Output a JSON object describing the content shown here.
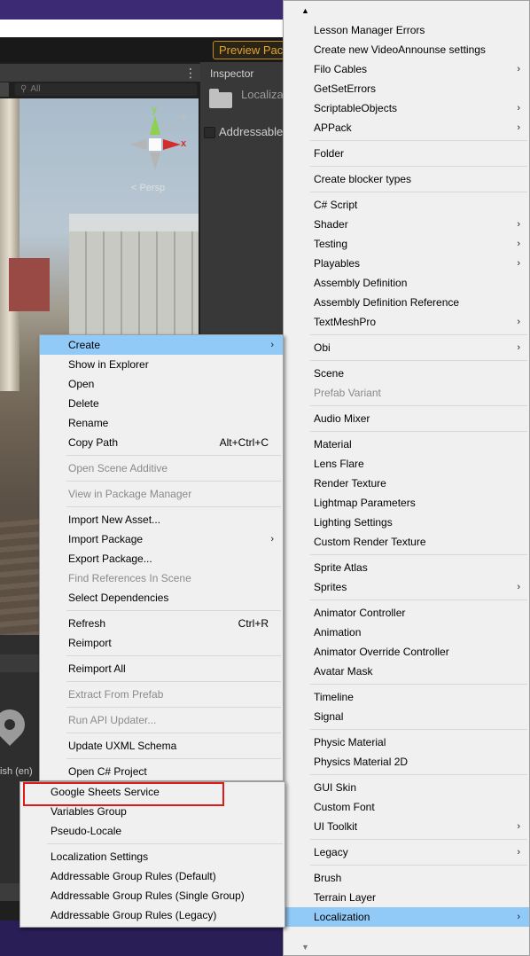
{
  "editor": {
    "preview_button": "Preview Pac",
    "scene_search_placeholder": "All",
    "scene_persp_label": "< Persp",
    "gizmo_y": "y",
    "gizmo_x": "x",
    "inspector_tab": "Inspector",
    "inspector_title": "Localiza",
    "inspector_addressable": "Addressable",
    "locale_label": "ish (en)"
  },
  "context_menu": {
    "items": [
      {
        "label": "Create",
        "arrow": "›"
      },
      {
        "label": "Show in Explorer"
      },
      {
        "label": "Open"
      },
      {
        "label": "Delete"
      },
      {
        "label": "Rename"
      },
      {
        "label": "Copy Path",
        "shortcut": "Alt+Ctrl+C"
      },
      {
        "label": "Open Scene Additive"
      },
      {
        "label": "View in Package Manager"
      },
      {
        "label": "Import New Asset..."
      },
      {
        "label": "Import Package",
        "arrow": "›"
      },
      {
        "label": "Export Package..."
      },
      {
        "label": "Find References In Scene"
      },
      {
        "label": "Select Dependencies"
      },
      {
        "label": "Refresh",
        "shortcut": "Ctrl+R"
      },
      {
        "label": "Reimport"
      },
      {
        "label": "Reimport All"
      },
      {
        "label": "Extract From Prefab"
      },
      {
        "label": "Run API Updater..."
      },
      {
        "label": "Update UXML Schema"
      },
      {
        "label": "Open C# Project"
      }
    ]
  },
  "create_menu": {
    "items": [
      {
        "label": "Lesson Manager Errors"
      },
      {
        "label": "Create new VideoAnnounse settings"
      },
      {
        "label": "Filo Cables",
        "arrow": "›"
      },
      {
        "label": "GetSetErrors"
      },
      {
        "label": "ScriptableObjects",
        "arrow": "›"
      },
      {
        "label": "APPack",
        "arrow": "›"
      },
      {
        "label": "Folder"
      },
      {
        "label": "Create blocker types"
      },
      {
        "label": "C# Script"
      },
      {
        "label": "Shader",
        "arrow": "›"
      },
      {
        "label": "Testing",
        "arrow": "›"
      },
      {
        "label": "Playables",
        "arrow": "›"
      },
      {
        "label": "Assembly Definition"
      },
      {
        "label": "Assembly Definition Reference"
      },
      {
        "label": "TextMeshPro",
        "arrow": "›"
      },
      {
        "label": "Obi",
        "arrow": "›"
      },
      {
        "label": "Scene"
      },
      {
        "label": "Prefab Variant"
      },
      {
        "label": "Audio Mixer"
      },
      {
        "label": "Material"
      },
      {
        "label": "Lens Flare"
      },
      {
        "label": "Render Texture"
      },
      {
        "label": "Lightmap Parameters"
      },
      {
        "label": "Lighting Settings"
      },
      {
        "label": "Custom Render Texture"
      },
      {
        "label": "Sprite Atlas"
      },
      {
        "label": "Sprites",
        "arrow": "›"
      },
      {
        "label": "Animator Controller"
      },
      {
        "label": "Animation"
      },
      {
        "label": "Animator Override Controller"
      },
      {
        "label": "Avatar Mask"
      },
      {
        "label": "Timeline"
      },
      {
        "label": "Signal"
      },
      {
        "label": "Physic Material"
      },
      {
        "label": "Physics Material 2D"
      },
      {
        "label": "GUI Skin"
      },
      {
        "label": "Custom Font"
      },
      {
        "label": "UI Toolkit",
        "arrow": "›"
      },
      {
        "label": "Legacy",
        "arrow": "›"
      },
      {
        "label": "Brush"
      },
      {
        "label": "Terrain Layer"
      },
      {
        "label": "Localization",
        "arrow": "›"
      }
    ]
  },
  "localization_menu": {
    "items": [
      {
        "label": "Google Sheets Service"
      },
      {
        "label": "Variables Group"
      },
      {
        "label": "Pseudo-Locale"
      },
      {
        "label": "Localization Settings"
      },
      {
        "label": "Addressable Group Rules (Default)"
      },
      {
        "label": "Addressable Group Rules (Single Group)"
      },
      {
        "label": "Addressable Group Rules (Legacy)"
      }
    ]
  },
  "colors": {
    "menu_bg": "#f0f0f0",
    "highlight": "#91c9f7",
    "disabled_text": "#8a8a8a",
    "annotation_box": "#e01a1a",
    "preview_button": "#e1a530"
  }
}
